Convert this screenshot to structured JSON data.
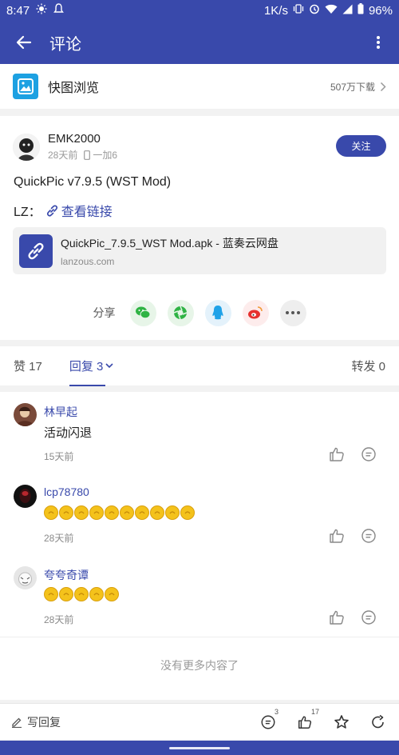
{
  "status_bar": {
    "time": "8:47",
    "speed": "1K/s",
    "battery": "96%"
  },
  "app_bar": {
    "title": "评论"
  },
  "app_card": {
    "name": "快图浏览",
    "downloads": "507万下载"
  },
  "post": {
    "author": "EMK2000",
    "time_ago": "28天前",
    "device": "一加6",
    "follow_label": "关注",
    "title": "QuickPic v7.9.5 (WST Mod)",
    "lz_label": "LZ：",
    "link_label": "查看链接",
    "link_card": {
      "title": "QuickPic_7.9.5_WST Mod.apk - 蓝奏云网盘",
      "domain": "lanzous.com"
    },
    "share_label": "分享"
  },
  "tabs": {
    "likes": "赞 17",
    "replies": "回复 3",
    "forwards": "转发 0"
  },
  "comments": [
    {
      "name": "林早起",
      "text": "活动闪退",
      "coins": 0,
      "time": "15天前"
    },
    {
      "name": "lcp78780",
      "text": "",
      "coins": 10,
      "time": "28天前"
    },
    {
      "name": "夸夸奇谭",
      "text": "",
      "coins": 5,
      "time": "28天前"
    }
  ],
  "no_more": "没有更多内容了",
  "bottom_bar": {
    "write_reply": "写回复",
    "comment_count": "3",
    "like_count": "17"
  },
  "colors": {
    "primary": "#3949ab",
    "coin": "#f4c21b"
  }
}
